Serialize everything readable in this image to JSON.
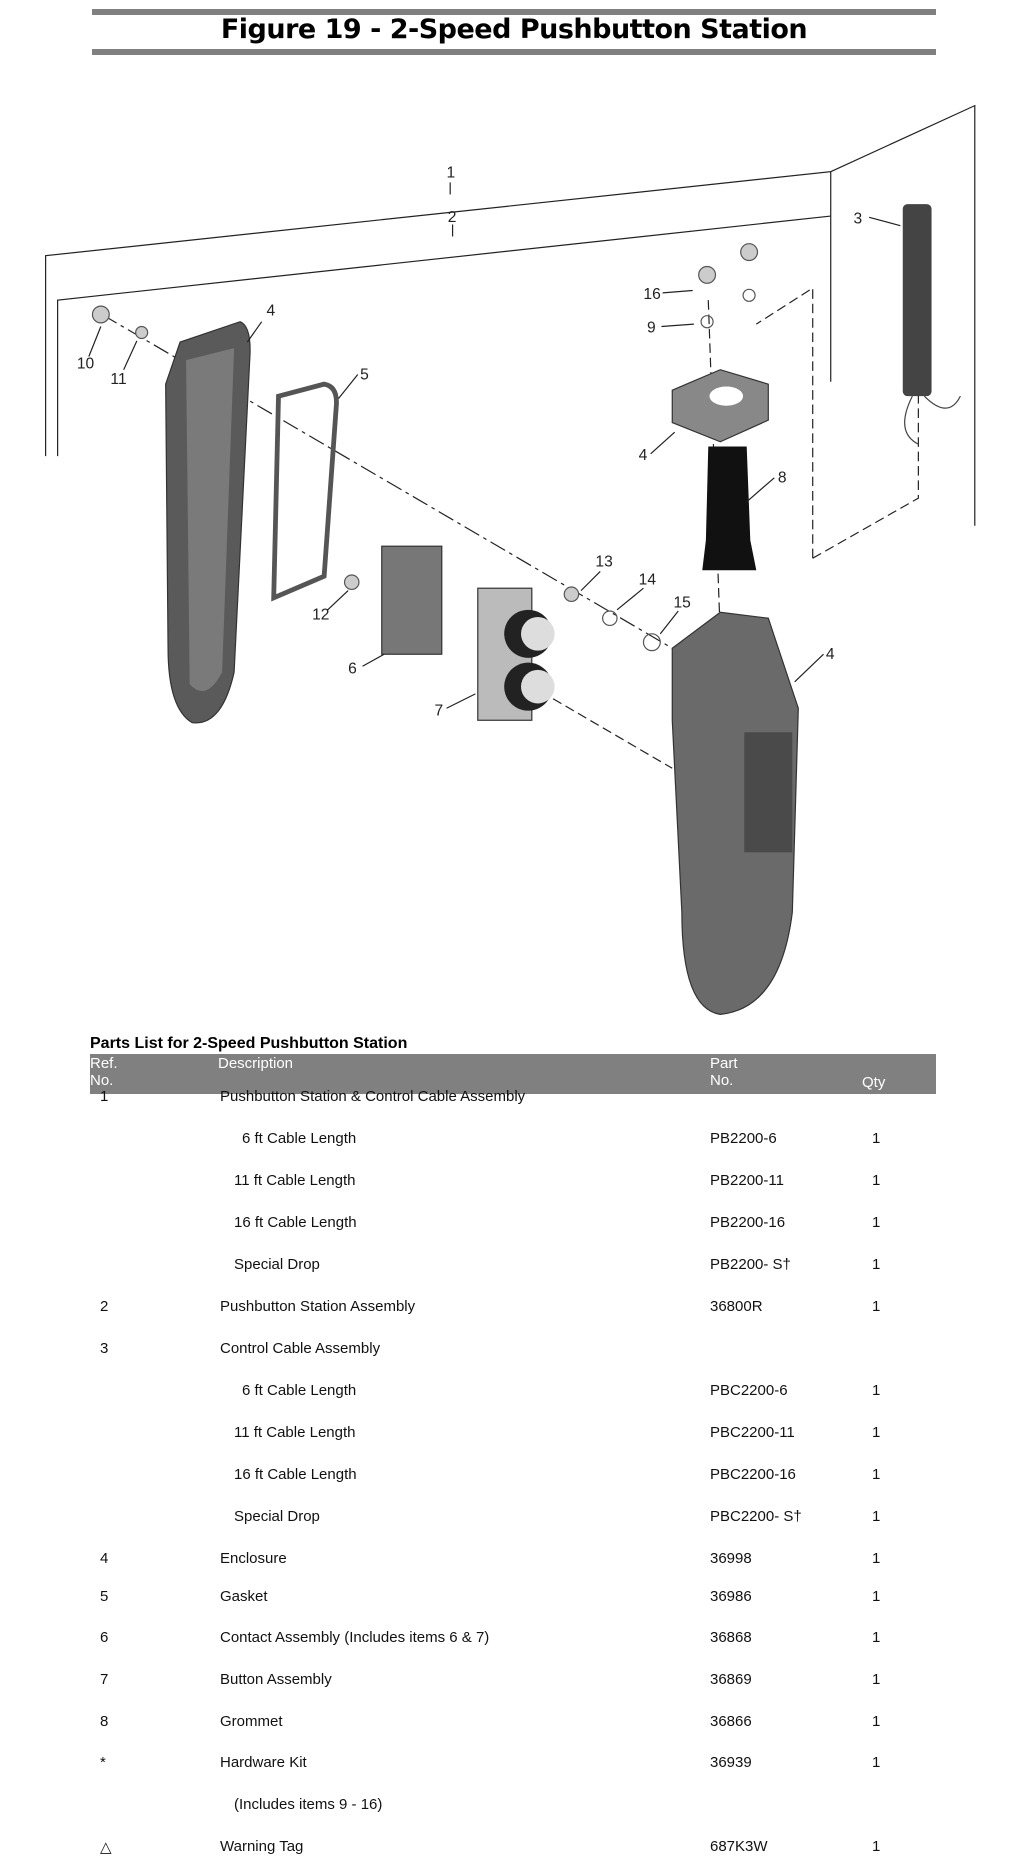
{
  "title": "Figure 19 - 2-Speed Pushbutton Station",
  "diagram": {
    "callouts": [
      "1",
      "2",
      "3",
      "4",
      "4",
      "4",
      "5",
      "6",
      "7",
      "8",
      "9",
      "10",
      "11",
      "12",
      "13",
      "14",
      "15",
      "16"
    ]
  },
  "parts_list": {
    "title": "Parts List for 2-Speed Pushbutton Station",
    "headers": {
      "ref_line1": "Ref.",
      "ref_line2": "No.",
      "description": "Description",
      "part_line1": "Part",
      "part_line2": "No.",
      "qty": "Qty"
    },
    "rows": [
      {
        "ref": "1",
        "description": "Pushbutton Station & Control Cable Assembly",
        "part": "",
        "qty": "",
        "indent": 0
      },
      {
        "ref": "",
        "description": "6 ft Cable Length",
        "part": "PB2200-6",
        "qty": "1",
        "indent": 2
      },
      {
        "ref": "",
        "description": "11 ft Cable Length",
        "part": "PB2200-11",
        "qty": "1",
        "indent": 1
      },
      {
        "ref": "",
        "description": "16 ft Cable Length",
        "part": "PB2200-16",
        "qty": "1",
        "indent": 1
      },
      {
        "ref": "",
        "description": "Special Drop",
        "part": "PB2200- S†",
        "qty": "1",
        "indent": 1
      },
      {
        "ref": "2",
        "description": "Pushbutton Station Assembly",
        "part": " 36800R",
        "qty": "1",
        "indent": 0
      },
      {
        "ref": "3",
        "description": "Control Cable Assembly",
        "part": "",
        "qty": "",
        "indent": 0
      },
      {
        "ref": "",
        "description": "6 ft Cable Length",
        "part": "PBC2200-6",
        "qty": "1",
        "indent": 2
      },
      {
        "ref": "",
        "description": "11 ft Cable Length",
        "part": "PBC2200-11",
        "qty": "1",
        "indent": 1
      },
      {
        "ref": "",
        "description": "16 ft Cable Length",
        "part": "PBC2200-16",
        "qty": "1",
        "indent": 1
      },
      {
        "ref": "",
        "description": "Special Drop",
        "part": "PBC2200- S†",
        "qty": "1",
        "indent": 1
      },
      {
        "ref": "4",
        "description": "Enclosure",
        "part": "36998",
        "qty": "1",
        "indent": 0
      },
      {
        "ref": "5",
        "description": "Gasket",
        "part": "36986",
        "qty": "1",
        "indent": 0
      },
      {
        "ref": "6",
        "description": "Contact Assembly (Includes items 6 & 7)",
        "part": "36868",
        "qty": "1",
        "indent": 0
      },
      {
        "ref": "7",
        "description": "Button Assembly",
        "part": "36869",
        "qty": "1",
        "indent": 0
      },
      {
        "ref": "8",
        "description": "Grommet",
        "part": "36866",
        "qty": "1",
        "indent": 0
      },
      {
        "ref": "*",
        "description": "Hardware Kit",
        "part": "36939",
        "qty": "1",
        "indent": 0
      },
      {
        "ref": "",
        "description": "(Includes items 9 - 16)",
        "part": "",
        "qty": "",
        "indent": 1
      },
      {
        "ref": "△",
        "description": "Warning Tag",
        "part": "687K3W",
        "qty": "1",
        "indent": 0
      }
    ]
  },
  "colors": {
    "header_bar": "#808080",
    "part_fill": "#5a5a5a"
  }
}
